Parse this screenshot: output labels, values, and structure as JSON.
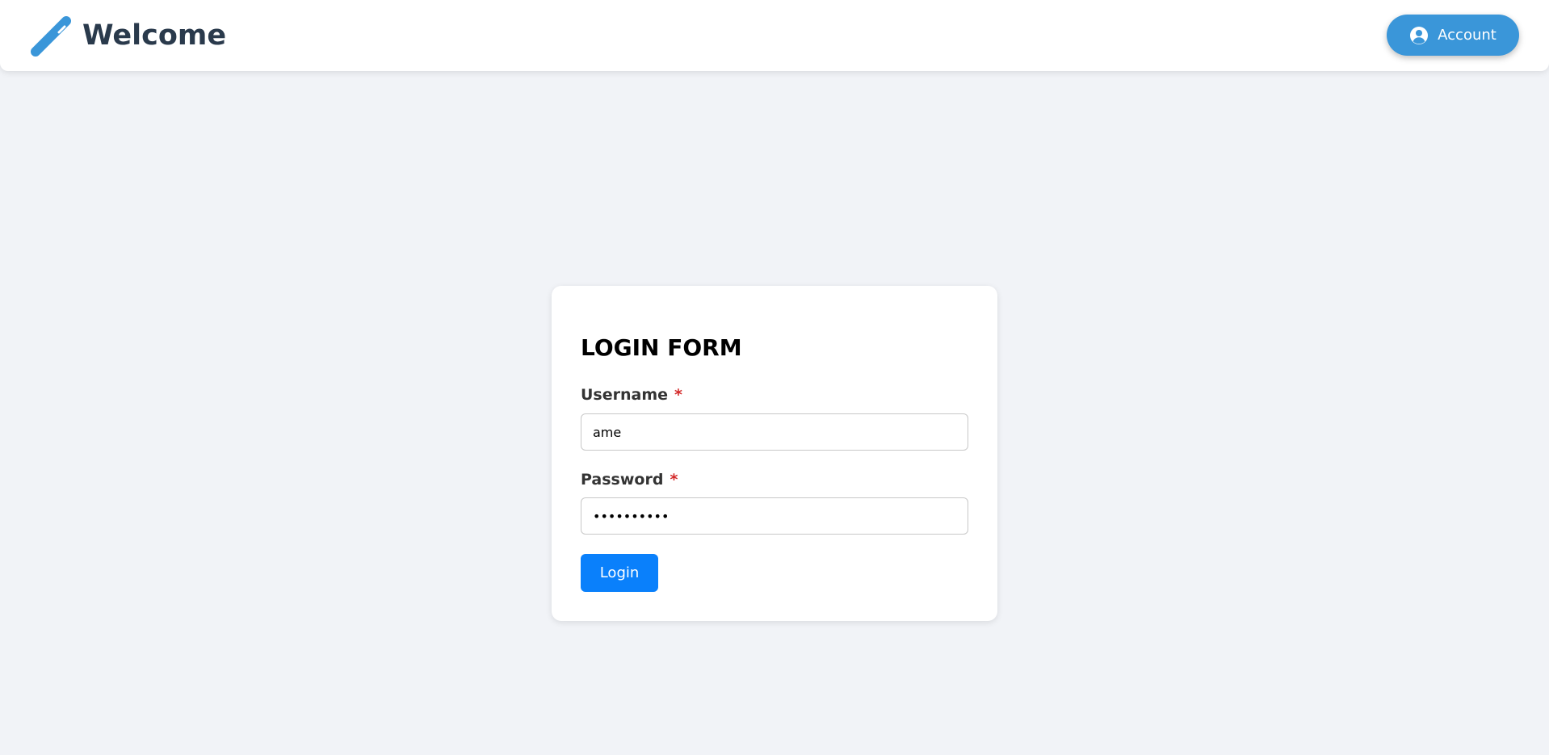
{
  "header": {
    "title": "Welcome",
    "brand_icon": "pencil-icon",
    "account_button": {
      "label": "Account",
      "icon": "user-circle-icon"
    }
  },
  "login_form": {
    "title": "LOGIN FORM",
    "username": {
      "label": "Username",
      "required_marker": "*",
      "value": "ame"
    },
    "password": {
      "label": "Password",
      "required_marker": "*",
      "value": "ameameame1"
    },
    "submit_label": "Login"
  },
  "colors": {
    "background": "#f1f3f7",
    "brand_accent": "#3a96d9",
    "primary_button": "#0a80fb",
    "required": "#d32828",
    "title_text": "#2a3a4c"
  }
}
